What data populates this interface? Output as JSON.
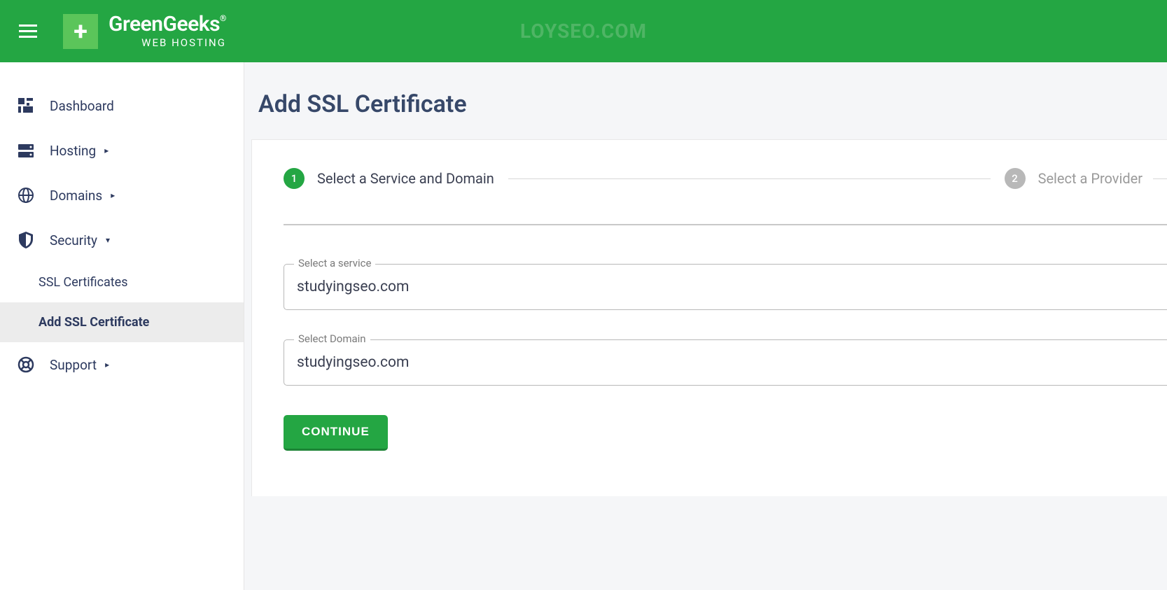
{
  "header": {
    "logo_main": "GreenGeeks",
    "logo_sub": "WEB HOSTING",
    "watermark": "LOYSEO.COM"
  },
  "sidebar": {
    "items": [
      {
        "label": "Dashboard",
        "icon": "dashboard",
        "arrow": ""
      },
      {
        "label": "Hosting",
        "icon": "server",
        "arrow": "▸"
      },
      {
        "label": "Domains",
        "icon": "globe",
        "arrow": "▸"
      },
      {
        "label": "Security",
        "icon": "shield",
        "arrow": "▾"
      },
      {
        "label": "Support",
        "icon": "lifebuoy",
        "arrow": "▸"
      }
    ],
    "security_sub": [
      {
        "label": "SSL Certificates",
        "active": false
      },
      {
        "label": "Add SSL Certificate",
        "active": true
      }
    ]
  },
  "page": {
    "title": "Add SSL Certificate"
  },
  "stepper": {
    "step1": {
      "num": "1",
      "label": "Select a Service and Domain"
    },
    "step2": {
      "num": "2",
      "label": "Select a Provider"
    }
  },
  "form": {
    "service_label": "Select a service",
    "service_value": "studyingseo.com",
    "domain_label": "Select Domain",
    "domain_value": "studyingseo.com",
    "continue_label": "CONTINUE"
  }
}
